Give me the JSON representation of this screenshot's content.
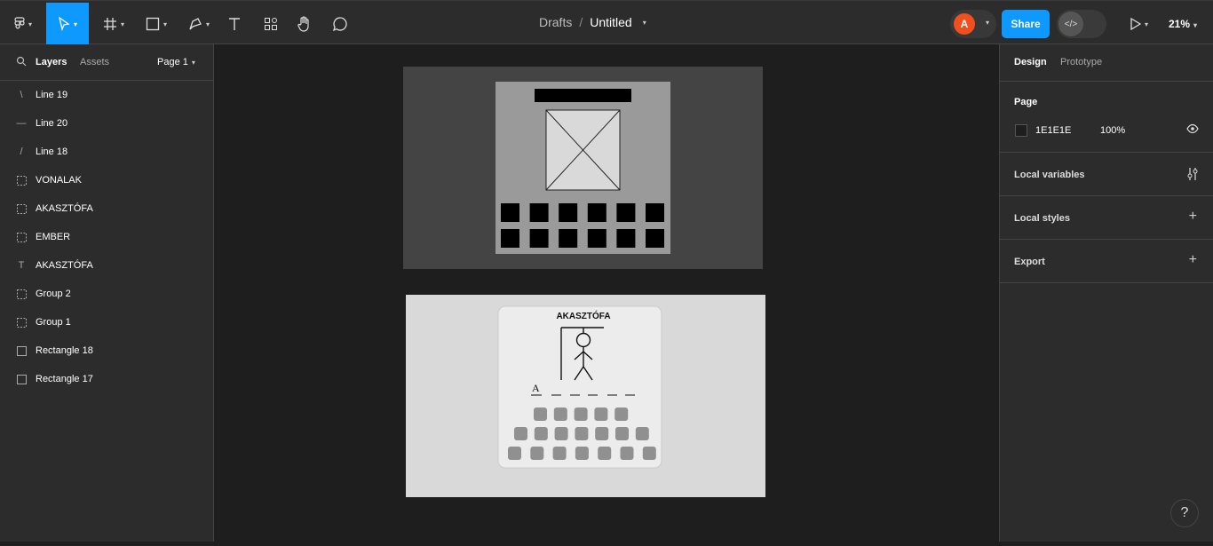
{
  "toolbar": {
    "tools": [
      "main-menu",
      "move",
      "frame",
      "shape",
      "pen",
      "text",
      "resources",
      "hand",
      "comment"
    ]
  },
  "breadcrumb": {
    "location": "Drafts",
    "separator": "/",
    "file": "Untitled"
  },
  "header": {
    "avatar_initial": "A",
    "share_label": "Share",
    "zoom": "21%"
  },
  "left_panel": {
    "tabs": {
      "layers": "Layers",
      "assets": "Assets"
    },
    "page_selector": "Page 1",
    "layers": [
      {
        "icon": "line-icon",
        "glyph": "\\",
        "label": "Line 19"
      },
      {
        "icon": "line-icon",
        "glyph": "—",
        "label": "Line 20"
      },
      {
        "icon": "line-icon",
        "glyph": "/",
        "label": "Line 18"
      },
      {
        "icon": "group-icon",
        "glyph": "",
        "label": "VONALAK"
      },
      {
        "icon": "group-icon",
        "glyph": "",
        "label": "AKASZTÓFA"
      },
      {
        "icon": "group-icon",
        "glyph": "",
        "label": "EMBER"
      },
      {
        "icon": "text-icon",
        "glyph": "T",
        "label": "AKASZTÓFA"
      },
      {
        "icon": "group-icon",
        "glyph": "",
        "label": "Group 2"
      },
      {
        "icon": "group-icon",
        "glyph": "",
        "label": "Group 1"
      },
      {
        "icon": "rectangle-icon",
        "glyph": "",
        "label": "Rectangle 18"
      },
      {
        "icon": "rectangle-icon",
        "glyph": "",
        "label": "Rectangle 17"
      }
    ]
  },
  "right_panel": {
    "tabs": {
      "design": "Design",
      "prototype": "Prototype"
    },
    "page_section": {
      "title": "Page",
      "color_hex": "1E1E1E",
      "opacity": "100%",
      "swatch": "#1e1e1e"
    },
    "local_variables": "Local variables",
    "local_styles": "Local styles",
    "export": "Export"
  },
  "canvas": {
    "mockup_title": "AKASZTÓFA",
    "guess_letter": "A",
    "colors": {
      "frame_dark": "#444444",
      "frame_light": "#d9d9d9",
      "card": "#9a9a9a",
      "key": "#000000",
      "soft_key": "#909090"
    }
  },
  "help_label": "?"
}
